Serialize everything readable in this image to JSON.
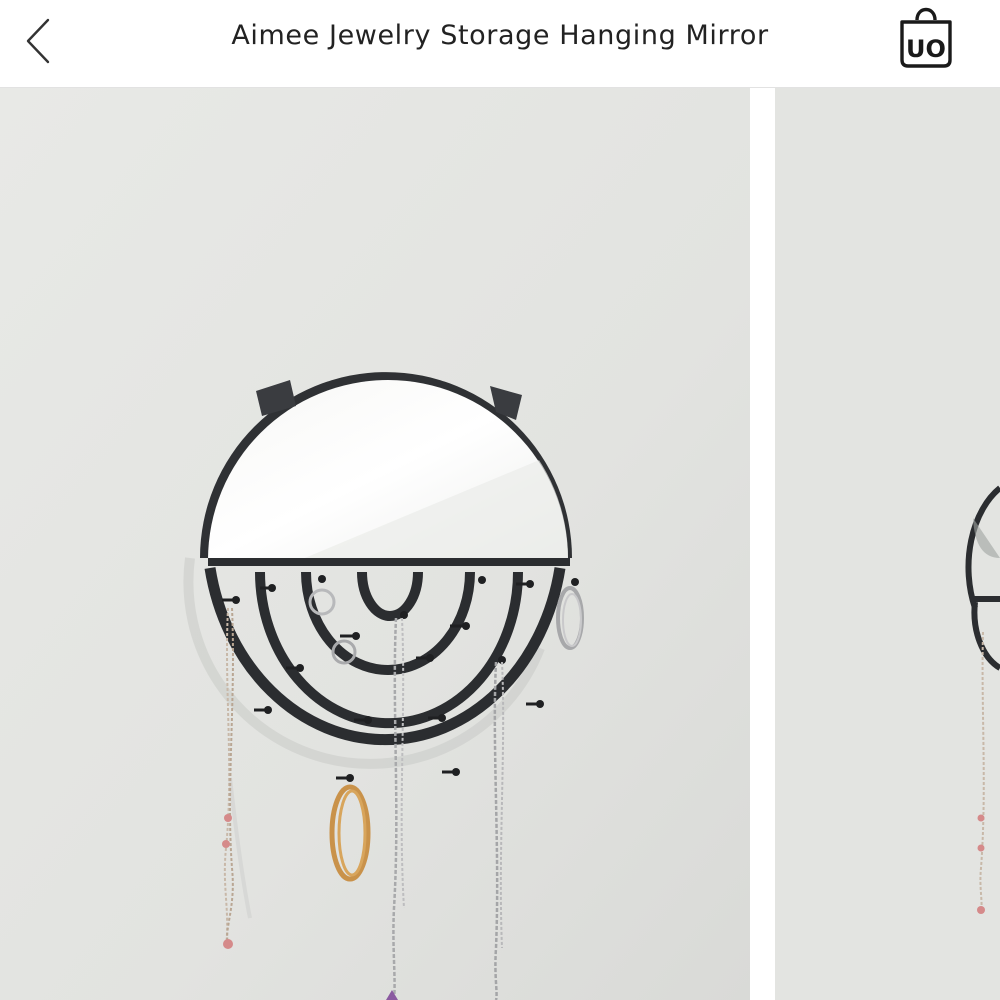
{
  "header": {
    "title": "Aimee Jewelry Storage Hanging Mirror",
    "back_icon": "chevron-left-icon",
    "bag_icon": "shopping-bag-icon",
    "bag_logo": "UO"
  },
  "gallery": {
    "images": [
      {
        "name": "product-image-1",
        "subject": "round hanging mirror with black jewelry hooks"
      },
      {
        "name": "product-image-2",
        "subject": "partial next product image"
      }
    ]
  },
  "colors": {
    "background": "#ffffff",
    "wall": "#e4e5e2",
    "frame": "#2b2d30",
    "text": "#222222"
  }
}
